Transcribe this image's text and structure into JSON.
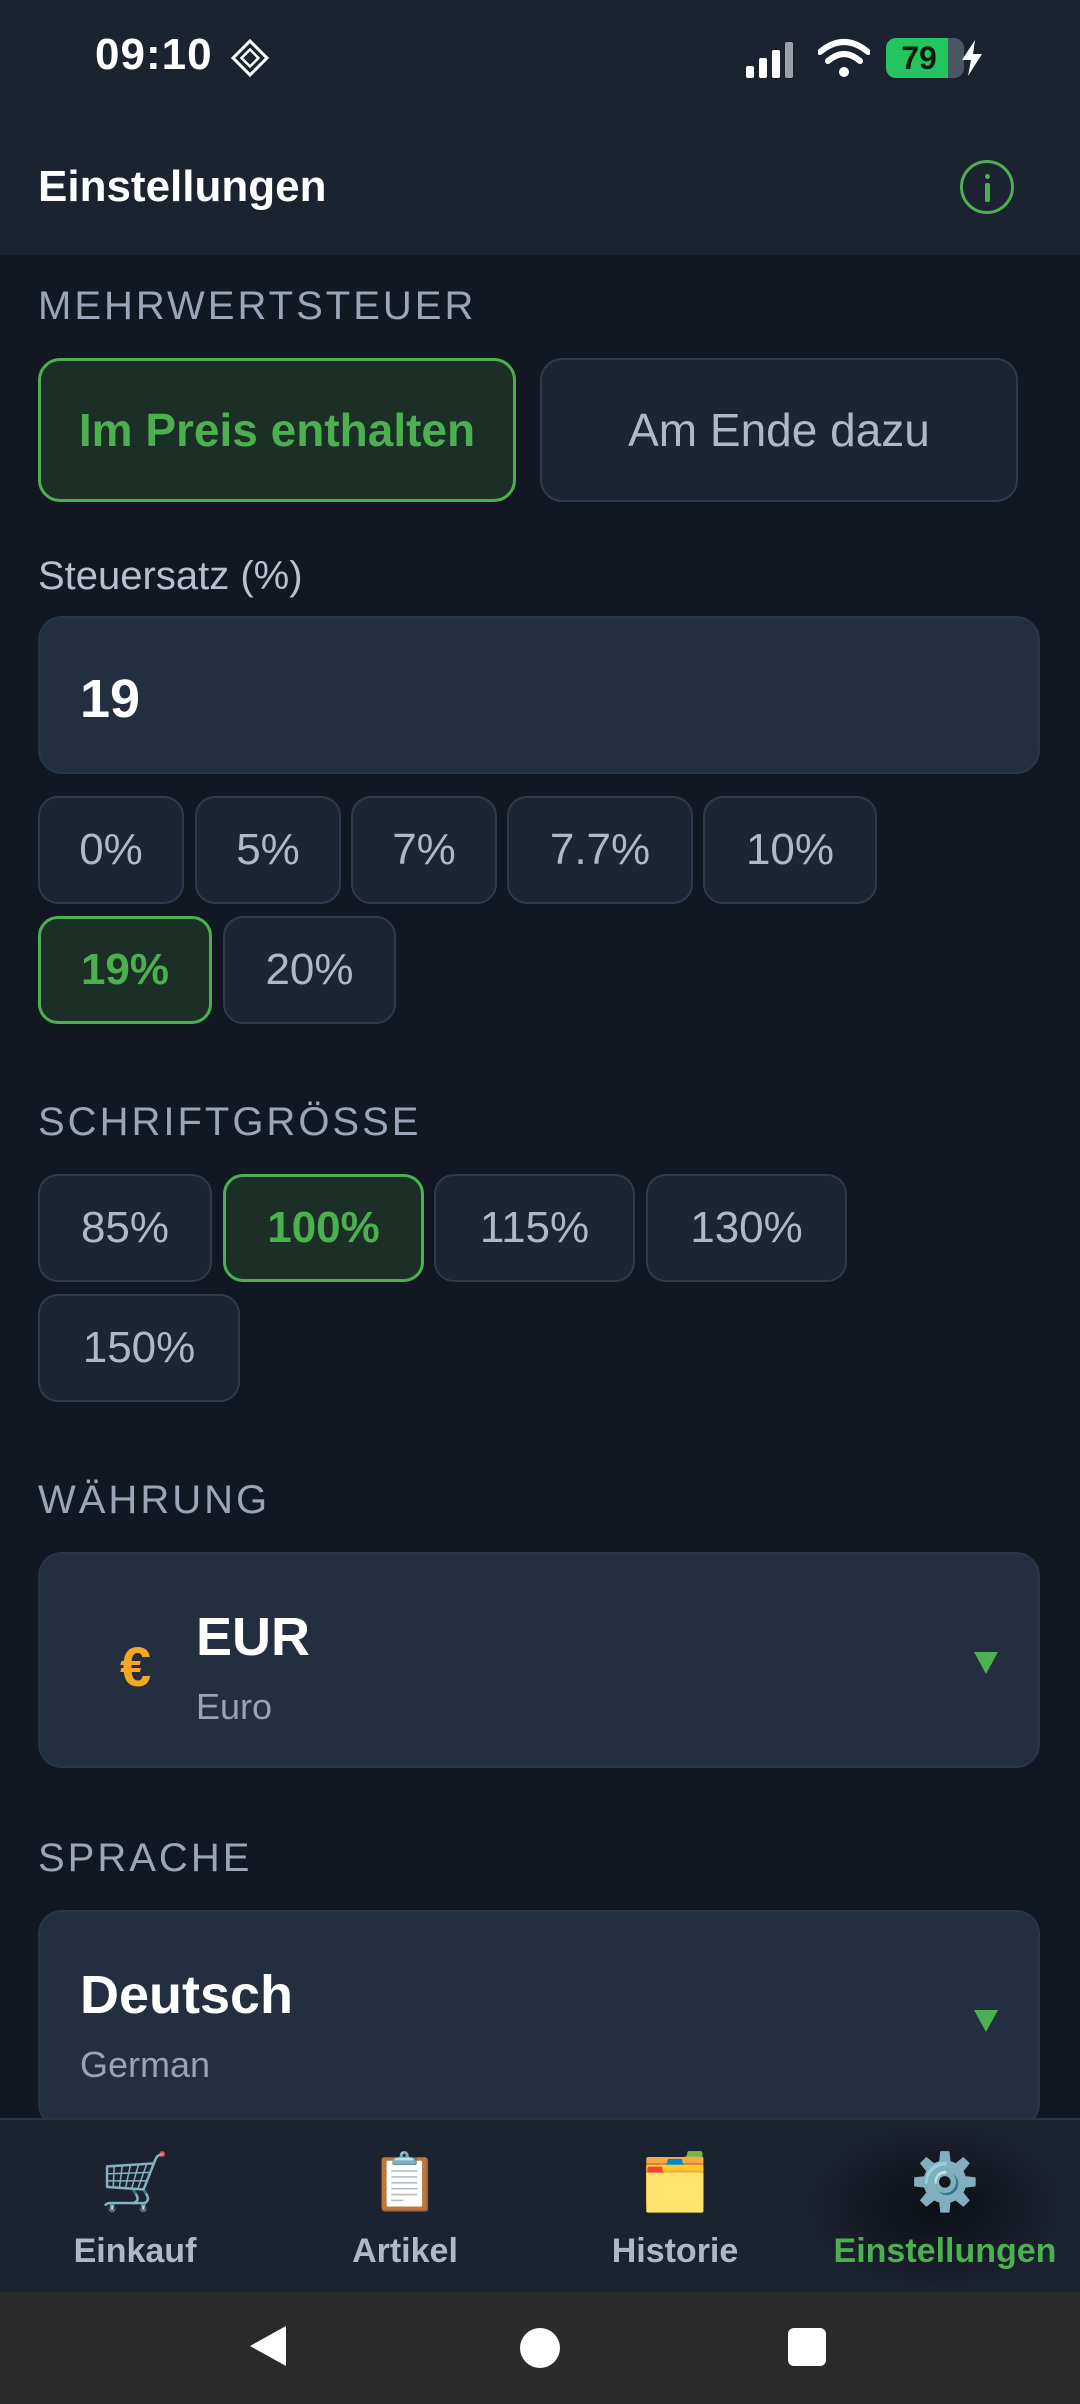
{
  "status_bar": {
    "time": "09:10",
    "battery_level": "79",
    "battery_fraction": 0.79,
    "icons": [
      "status-notification-icon",
      "signal-icon",
      "wifi-icon",
      "battery-icon",
      "charging-bolt-icon"
    ]
  },
  "header": {
    "title": "Einstellungen",
    "info_icon": "info-icon"
  },
  "vat": {
    "section_label": "MEHRWERTSTEUER",
    "modes": [
      {
        "label": "Im Preis enthalten",
        "active": true
      },
      {
        "label": "Am Ende dazu",
        "active": false
      }
    ],
    "rate_label": "Steuersatz (%)",
    "rate_value": "19",
    "rate_chips": [
      {
        "label": "0%",
        "active": false
      },
      {
        "label": "5%",
        "active": false
      },
      {
        "label": "7%",
        "active": false
      },
      {
        "label": "7.7%",
        "active": false
      },
      {
        "label": "10%",
        "active": false
      },
      {
        "label": "19%",
        "active": true
      },
      {
        "label": "20%",
        "active": false
      }
    ]
  },
  "font_size": {
    "section_label": "SCHRIFTGRÖSSE",
    "chips": [
      {
        "label": "85%",
        "active": false
      },
      {
        "label": "100%",
        "active": true
      },
      {
        "label": "115%",
        "active": false
      },
      {
        "label": "130%",
        "active": false
      },
      {
        "label": "150%",
        "active": false
      }
    ]
  },
  "currency": {
    "section_label": "WÄHRUNG",
    "symbol": "€",
    "code": "EUR",
    "name": "Euro"
  },
  "language": {
    "section_label": "SPRACHE",
    "name": "Deutsch",
    "english_name": "German"
  },
  "bottom_nav": {
    "items": [
      {
        "label": "Einkauf",
        "icon": "🛒",
        "icon_name": "shopping-cart-icon",
        "active": false
      },
      {
        "label": "Artikel",
        "icon": "📋",
        "icon_name": "clipboard-icon",
        "active": false
      },
      {
        "label": "Historie",
        "icon": "🗂️",
        "icon_name": "folder-icon",
        "active": false
      },
      {
        "label": "Einstellungen",
        "icon": "⚙️",
        "icon_name": "gear-icon",
        "active": true
      }
    ]
  },
  "colors": {
    "accent": "#4caf50",
    "background": "#111821",
    "header": "#1b2330",
    "card": "#232e40",
    "currency_symbol": "#f5a623"
  }
}
